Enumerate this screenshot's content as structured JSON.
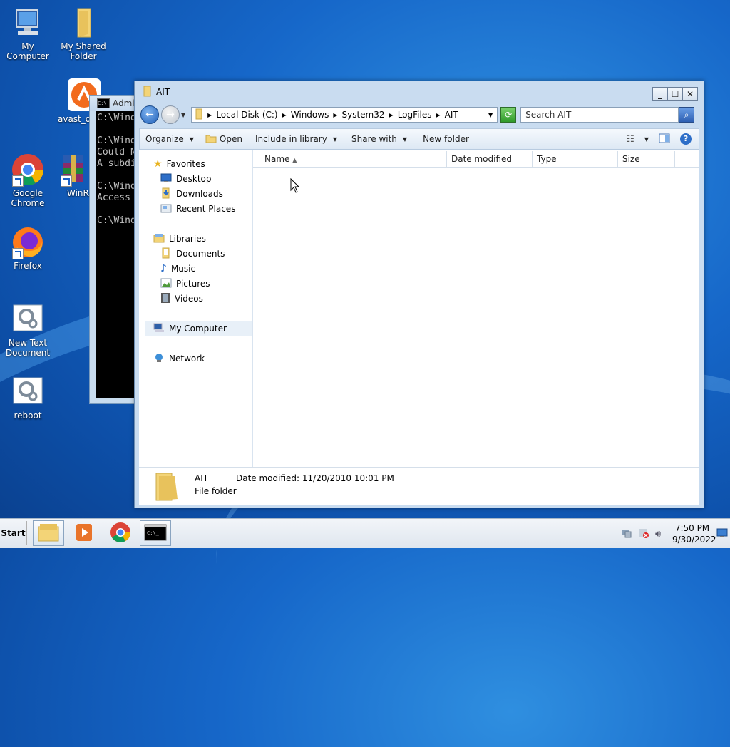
{
  "desktop": {
    "icons": [
      {
        "label": "My Computer"
      },
      {
        "label": "My Shared Folder"
      },
      {
        "label": "avast_on"
      },
      {
        "label": "Google Chrome"
      },
      {
        "label": "WinRA"
      },
      {
        "label": "Firefox"
      },
      {
        "label": "New Text Document"
      },
      {
        "label": "reboot"
      }
    ]
  },
  "cmd": {
    "title": "Admi",
    "lines": "C:\\Wind\n\nC:\\Wind\nCould N\nA subdi\n\nC:\\Wind\nAccess \n\nC:\\Wind"
  },
  "explorer": {
    "title": "AIT",
    "breadcrumbs": [
      "Local Disk (C:)",
      "Windows",
      "System32",
      "LogFiles",
      "AIT"
    ],
    "search_placeholder": "Search AIT",
    "toolbar": {
      "organize": "Organize",
      "open": "Open",
      "include": "Include in library",
      "share": "Share with",
      "new_folder": "New folder"
    },
    "nav": {
      "favorites": "Favorites",
      "desktop": "Desktop",
      "downloads": "Downloads",
      "recent": "Recent Places",
      "libraries": "Libraries",
      "documents": "Documents",
      "music": "Music",
      "pictures": "Pictures",
      "videos": "Videos",
      "computer": "My Computer",
      "network": "Network"
    },
    "columns": [
      "Name",
      "Date modified",
      "Type",
      "Size"
    ],
    "details": {
      "name": "AIT",
      "type": "File folder",
      "date": "Date modified: 11/20/2010 10:01 PM"
    }
  },
  "taskbar": {
    "start": "Start",
    "time": "7:50 PM",
    "date": "9/30/2022"
  }
}
